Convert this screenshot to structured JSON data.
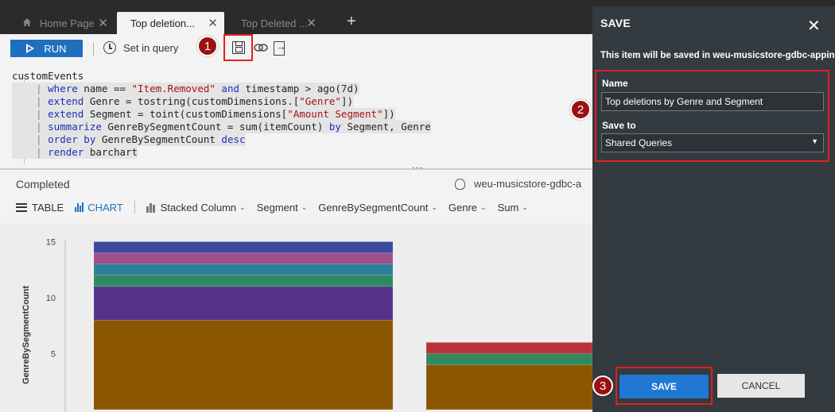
{
  "tabs": [
    {
      "label": "Home Page"
    },
    {
      "label": "Top deletion..."
    },
    {
      "label": "Top Deleted ..."
    }
  ],
  "toolbar": {
    "run_label": "RUN",
    "set_in_query_label": "Set in query"
  },
  "editor": {
    "lines": [
      {
        "pre": "customEvents",
        "parts": []
      },
      {
        "pre": "",
        "parts": [
          [
            "kw",
            "where"
          ],
          [
            "t",
            " name == "
          ],
          [
            "str",
            "\"Item.Removed\""
          ],
          [
            "t",
            " "
          ],
          [
            "kw",
            "and"
          ],
          [
            "t",
            " timestamp > ago(7d)"
          ]
        ]
      },
      {
        "pre": "",
        "parts": [
          [
            "kw",
            "extend"
          ],
          [
            "t",
            " Genre = tostring(customDimensions.["
          ],
          [
            "str",
            "\"Genre\""
          ],
          [
            "t",
            "])"
          ]
        ]
      },
      {
        "pre": "",
        "parts": [
          [
            "kw",
            "extend"
          ],
          [
            "t",
            " Segment = toint(customDimensions["
          ],
          [
            "str",
            "\"Amount Segment\""
          ],
          [
            "t",
            "])"
          ]
        ]
      },
      {
        "pre": "",
        "parts": [
          [
            "kw",
            "summarize"
          ],
          [
            "t",
            " GenreBySegmentCount = sum(itemCount) "
          ],
          [
            "kw",
            "by"
          ],
          [
            "t",
            " Segment, Genre"
          ]
        ]
      },
      {
        "pre": "",
        "parts": [
          [
            "kw",
            "order by"
          ],
          [
            "t",
            " GenreBySegmentCount "
          ],
          [
            "kw",
            "desc"
          ]
        ]
      },
      {
        "pre": "",
        "parts": [
          [
            "kw",
            "render"
          ],
          [
            "t",
            " barchart"
          ]
        ]
      }
    ]
  },
  "results": {
    "status": "Completed",
    "resource": "weu-musicstore-gdbc-a",
    "views": {
      "table_label": "TABLE",
      "chart_label": "CHART",
      "chart_type": "Stacked Column",
      "x_field": "Segment",
      "y_field": "GenreBySegmentCount",
      "split_field": "Genre",
      "aggregation": "Sum"
    }
  },
  "chart_data": {
    "type": "bar",
    "stacked": true,
    "ylabel": "GenreBySegmentCount",
    "y_ticks": [
      5,
      10,
      15
    ],
    "bars": [
      {
        "segments": [
          {
            "value": 8,
            "color": "#8a5600"
          },
          {
            "value": 3,
            "color": "#55338a"
          },
          {
            "value": 1,
            "color": "#2e8a62"
          },
          {
            "value": 1,
            "color": "#2b7f99"
          },
          {
            "value": 1,
            "color": "#9c508c"
          },
          {
            "value": 1,
            "color": "#3b4aa0"
          }
        ]
      },
      {
        "segments": [
          {
            "value": 4,
            "color": "#8a5600"
          },
          {
            "value": 1,
            "color": "#2e8a62"
          },
          {
            "value": 1,
            "color": "#b8343a"
          }
        ]
      }
    ]
  },
  "save_panel": {
    "title": "SAVE",
    "note": "This item will be saved in weu-musicstore-gdbc-appins",
    "name_label": "Name",
    "name_value": "Top deletions by Genre and Segment",
    "save_to_label": "Save to",
    "save_to_value": "Shared Queries",
    "save_label": "SAVE",
    "cancel_label": "CANCEL"
  },
  "callouts": [
    "1",
    "2",
    "3"
  ],
  "colors": {
    "accent": "#1f78d1",
    "callout": "#9b1010",
    "highlight_border": "#e02020",
    "panel_bg": "#333a40"
  }
}
